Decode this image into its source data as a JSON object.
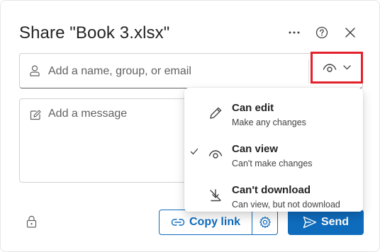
{
  "dialog": {
    "title": "Share \"Book 3.xlsx\""
  },
  "header_actions": {
    "more_icon": "more-horizontal-icon",
    "help_icon": "question-circle-icon",
    "close_icon": "close-icon"
  },
  "recipient": {
    "placeholder": "Add a name, group, or email",
    "icon": "person-icon"
  },
  "permission_button": {
    "icon": "eye-icon",
    "chevron": "chevron-down-icon",
    "highlight_color": "#e3202b"
  },
  "message": {
    "placeholder": "Add a message",
    "icon": "edit-message-icon"
  },
  "footer": {
    "copy_link_label": "Copy link",
    "send_label": "Send",
    "accent_color": "#0f6cbd"
  },
  "permission_menu": {
    "items": [
      {
        "label": "Can edit",
        "description": "Make any changes",
        "icon": "pencil-icon",
        "selected": false
      },
      {
        "label": "Can view",
        "description": "Can't make changes",
        "icon": "eye-icon",
        "selected": true
      },
      {
        "label": "Can't download",
        "description": "Can view, but not download",
        "icon": "no-download-icon",
        "selected": false
      }
    ]
  }
}
